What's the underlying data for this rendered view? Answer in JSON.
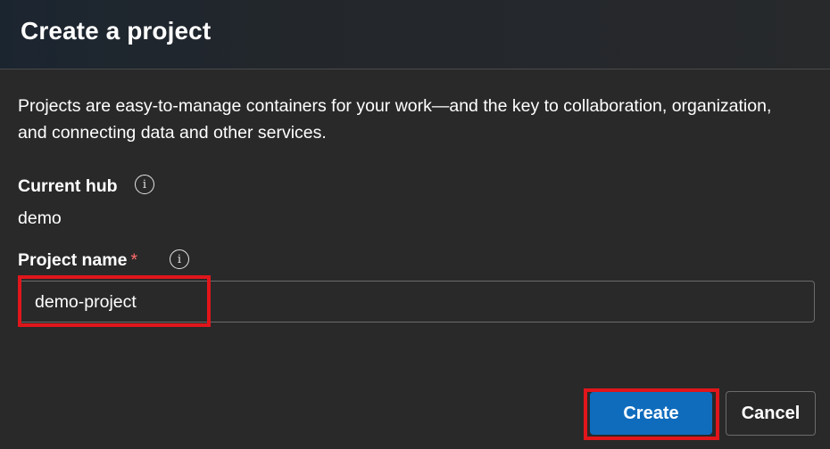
{
  "dialog": {
    "title": "Create a project",
    "description": "Projects are easy-to-manage containers for your work—and the key to collaboration, organization, and connecting data and other services."
  },
  "fields": {
    "current_hub": {
      "label": "Current hub",
      "value": "demo",
      "info_icon": "info-icon"
    },
    "project_name": {
      "label": "Project name",
      "required_marker": "*",
      "value": "demo-project",
      "info_icon": "info-icon"
    }
  },
  "actions": {
    "create_label": "Create",
    "cancel_label": "Cancel"
  },
  "colors": {
    "background": "#292929",
    "primary_button": "#0f6cbd",
    "required_marker": "#ff6b6b",
    "highlight_box": "#e0161b"
  }
}
